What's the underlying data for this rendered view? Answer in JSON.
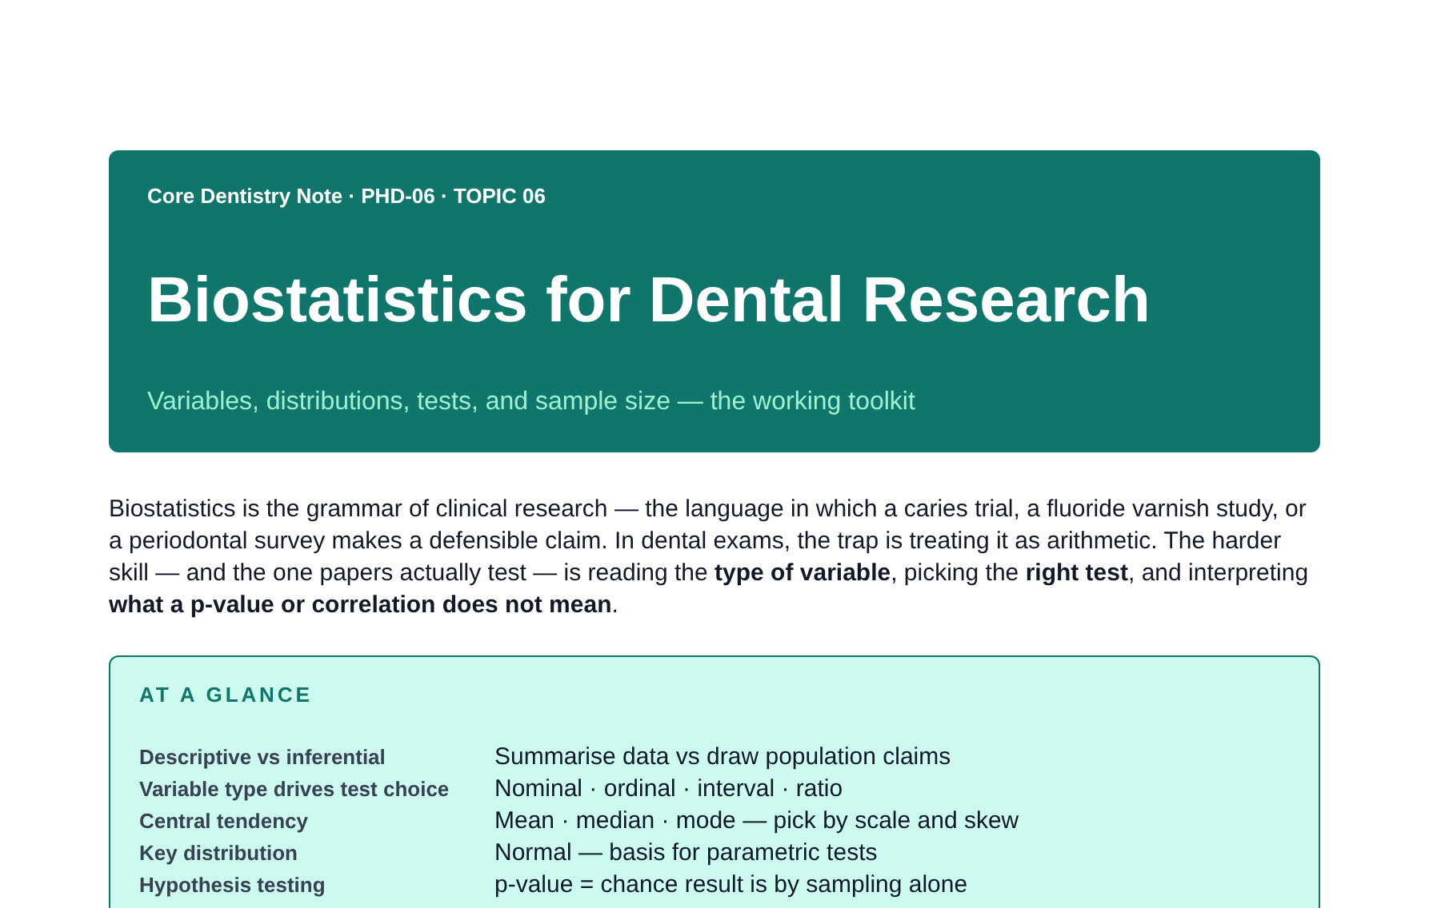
{
  "header": {
    "eyebrow": "Core Dentistry Note · PHD-06 · TOPIC 06",
    "title": "Biostatistics for Dental Research",
    "subtitle": "Variables, distributions, tests, and sample size — the working toolkit"
  },
  "intro": "Biostatistics is the grammar of clinical research — the language in which a caries trial, a fluoride varnish study, or a periodontal survey makes a defensible claim. In dental exams, the trap is treating it as arithmetic. The harder skill — and the one papers actually test — is reading the **type of variable**, picking the **right test**, and interpreting **what a p-value or correlation does not mean**.",
  "glance": {
    "heading": "AT A GLANCE",
    "rows": [
      {
        "label": "Descriptive vs inferential",
        "value": "Summarise data vs draw population claims"
      },
      {
        "label": "Variable type drives test choice",
        "value": "Nominal · ordinal · interval · ratio"
      },
      {
        "label": "Central tendency",
        "value": "Mean · median · mode — pick by scale and skew"
      },
      {
        "label": "Key distribution",
        "value": "Normal — basis for parametric tests"
      },
      {
        "label": "Hypothesis testing",
        "value": "p-value = chance result is by sampling alone"
      }
    ]
  }
}
